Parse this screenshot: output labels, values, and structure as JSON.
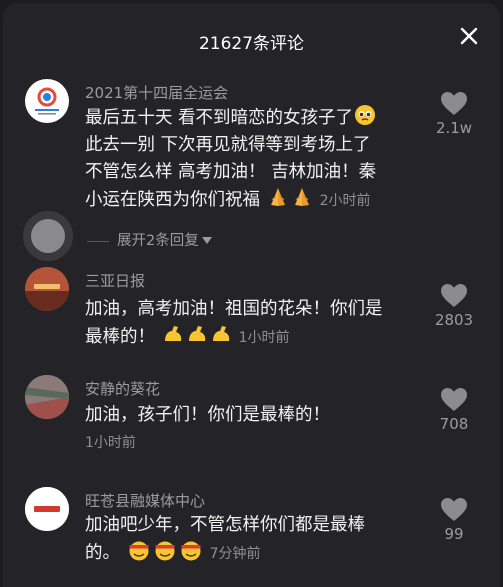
{
  "header": {
    "title": "21627条评论",
    "close_icon": "close-icon"
  },
  "comments": [
    {
      "author": "2021第十四届全运会",
      "avatar_icon": "games-logo-avatar",
      "lines": [
        "最后五十天 看不到暗恋的女孩子了",
        "此去一别 下次再见就得等到考场上了",
        "不管怎么样 高考加油！ 吉林加油！秦",
        "小运在陕西为你们祝福"
      ],
      "time": "2小时前",
      "likes": "2.1w",
      "emoji_names": [
        "pleading-face-emoji",
        "praying-hands-emoji"
      ]
    },
    {
      "author": "三亚日报",
      "avatar_icon": "sanya-daily-avatar",
      "lines": [
        "加油，高考加油！祖国的花朵！你们是",
        "最棒的！"
      ],
      "time": "1小时前",
      "likes": "2803",
      "emoji_names": [
        "flexed-biceps-emoji"
      ]
    },
    {
      "author": "安静的葵花",
      "avatar_icon": "user-avatar",
      "lines": [
        "加油，孩子们！你们是最棒的！"
      ],
      "time": "1小时前",
      "likes": "708"
    },
    {
      "author": "旺苍县融媒体中心",
      "avatar_icon": "media-center-avatar",
      "lines": [
        "加油吧少年，不管怎样你们都是最棒",
        "的。"
      ],
      "time": "7分钟前",
      "likes": "99",
      "emoji_names": [
        "headband-fighting-emoji"
      ]
    }
  ],
  "expand_replies": "展开2条回复",
  "colors": {
    "background": "#242428",
    "text": "#f2f2f2",
    "muted": "#9b9ba0"
  }
}
